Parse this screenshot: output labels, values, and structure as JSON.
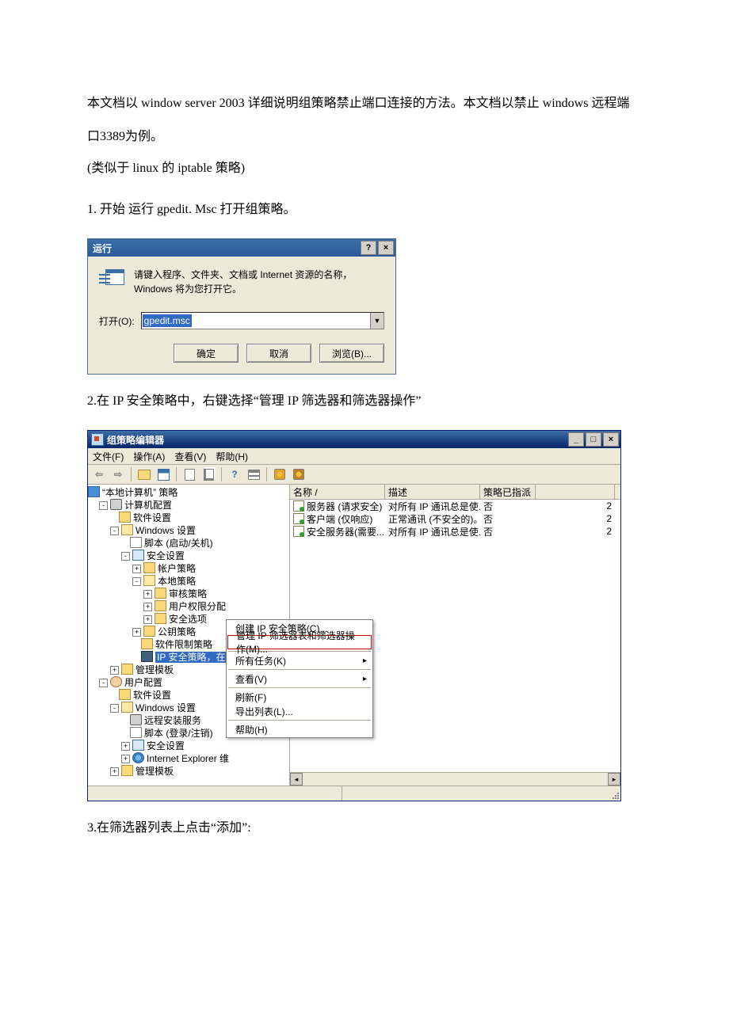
{
  "doc": {
    "p1": "本文档以 window server 2003  详细说明组策略禁止端口连接的方法。本文档以禁止 windows 远程端口3389为例。",
    "p2": "(类似于 linux 的 iptable 策略)",
    "p3": "1.  开始  运行  gpedit. Msc 打开组策略。",
    "p4": "2.在 IP 安全策略中，右键选择“管理 IP 筛选器和筛选器操作”",
    "p5": "3.在筛选器列表上点击“添加”:"
  },
  "run": {
    "title": "运行",
    "desc": "请键入程序、文件夹、文档或 Internet 资源的名称，Windows 将为您打开它。",
    "open_label": "打开(O):",
    "value": "gpedit.msc",
    "ok": "确定",
    "cancel": "取消",
    "browse": "浏览(B)..."
  },
  "gp": {
    "title": "组策略编辑器",
    "menu": {
      "file": "文件(F)",
      "action": "操作(A)",
      "view": "查看(V)",
      "help": "帮助(H)"
    },
    "tree": {
      "root": "“本地计算机” 策略",
      "comp": "计算机配置",
      "sw": "软件设置",
      "win": "Windows 设置",
      "script1": "脚本 (启动/关机)",
      "sec": "安全设置",
      "acct": "帐户策略",
      "local": "本地策略",
      "audit": "审核策略",
      "userrights": "用户权限分配",
      "secopt": "安全选项",
      "pubkey": "公钥策略",
      "swrestrict": "软件限制策略",
      "ipsec": "IP 安全策略，在 本地计算机",
      "admtpl": "管理模板",
      "user": "用户配置",
      "sw2": "软件设置",
      "win2": "Windows 设置",
      "remote": "远程安装服务",
      "script2": "脚本 (登录/注销)",
      "sec2": "安全设置",
      "ie": "Internet Explorer 维",
      "admtpl2": "管理模板"
    },
    "cols": {
      "name": "名称  /",
      "desc": "描述",
      "assigned": "策略已指派"
    },
    "rows": [
      {
        "name": "服务器 (请求安全)",
        "desc": "对所有 IP 通讯总是使...",
        "assigned": "否",
        "last": "2"
      },
      {
        "name": "客户端 (仅响应)",
        "desc": "正常通讯 (不安全的)。...",
        "assigned": "否",
        "last": "2"
      },
      {
        "name": "安全服务器(需要...",
        "desc": "对所有 IP 通讯总是使...",
        "assigned": "否",
        "last": "2"
      }
    ],
    "ctx": {
      "create": "创建 IP 安全策略(C)...",
      "manage": "管理 IP 筛选器表和筛选器操作(M)...",
      "alltasks": "所有任务(K)",
      "view": "查看(V)",
      "refresh": "刷新(F)",
      "export": "导出列表(L)...",
      "help": "帮助(H)"
    }
  }
}
